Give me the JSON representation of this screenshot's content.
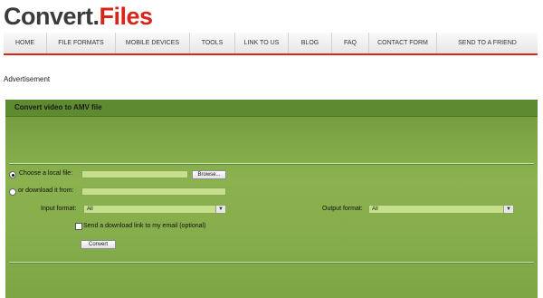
{
  "logo": {
    "part1": "Convert.",
    "part2": "Files"
  },
  "nav": {
    "items": [
      "HOME",
      "FILE FORMATS",
      "MOBILE DEVICES",
      "TOOLS",
      "LINK TO US",
      "BLOG",
      "FAQ",
      "CONTACT FORM",
      "SEND TO A FRIEND"
    ]
  },
  "advertisement": "Advertisement",
  "panel": {
    "title": "Convert video to AMV file",
    "local_file_label": "Choose a local file:",
    "browse_label": "Browse...",
    "download_label": "or download it from:",
    "input_format_label": "Input format:",
    "input_format_value": "All",
    "output_format_label": "Output format:",
    "output_format_value": "All",
    "email_option_label": "Send a download link to my email (optional)",
    "convert_label": "Convert"
  },
  "colors": {
    "accent_red": "#d7251a",
    "panel_green": "#86ad4b",
    "field_green": "#c6df8b"
  }
}
